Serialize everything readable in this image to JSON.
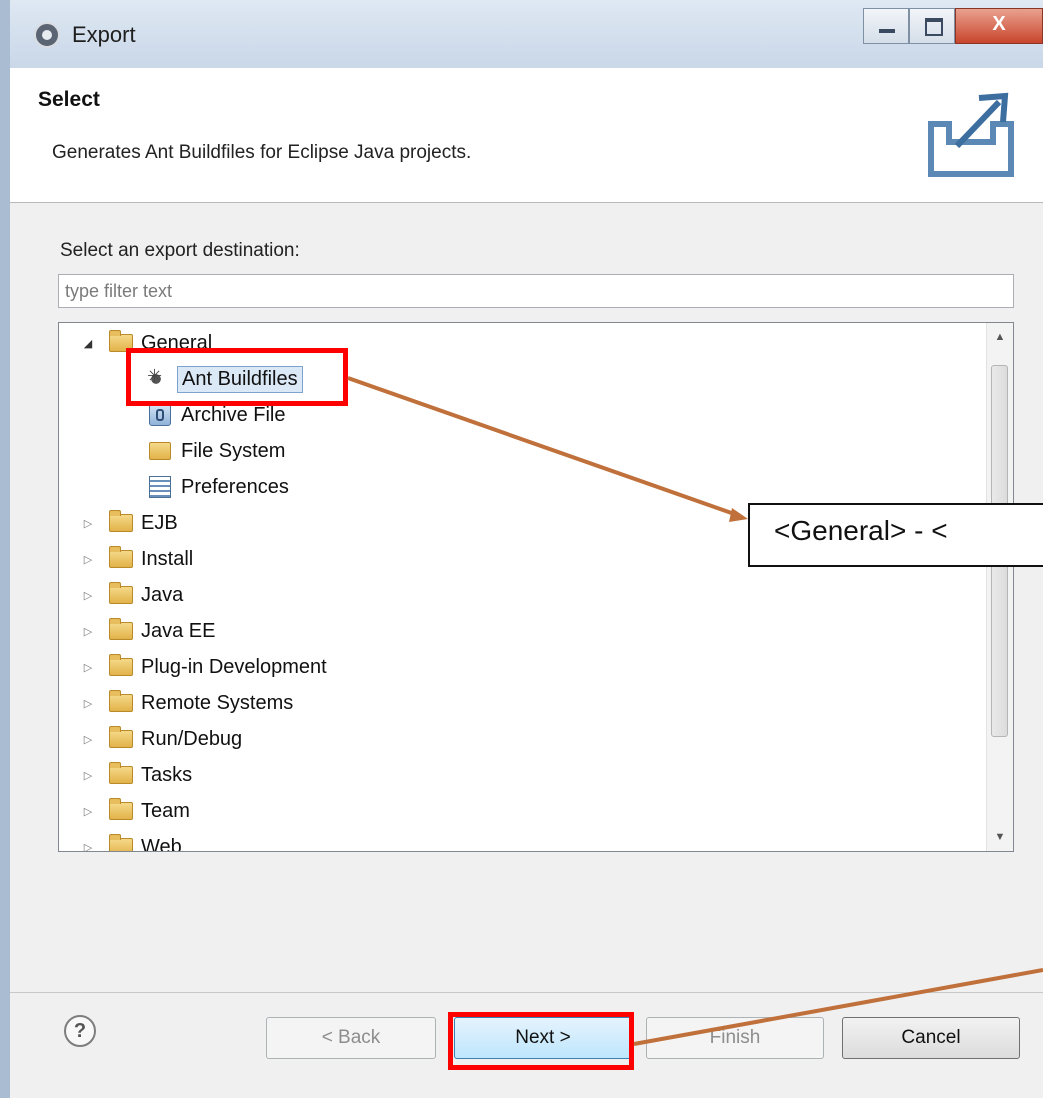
{
  "window": {
    "title": "Export",
    "minimize_icon": "minimize-icon",
    "maximize_icon": "maximize-icon",
    "close_symbol": "X"
  },
  "header": {
    "title": "Select",
    "description": "Generates Ant Buildfiles for Eclipse Java projects.",
    "icon": "export-banner-icon"
  },
  "body": {
    "prompt": "Select an export destination:",
    "filter_placeholder": "type filter text"
  },
  "tree": {
    "general": {
      "label": "General",
      "expanded": true,
      "children": [
        {
          "label": "Ant Buildfiles",
          "icon": "ant-icon",
          "selected": true
        },
        {
          "label": "Archive File",
          "icon": "archive-file-icon"
        },
        {
          "label": "File System",
          "icon": "folder-icon"
        },
        {
          "label": "Preferences",
          "icon": "preferences-icon"
        }
      ]
    },
    "categories": [
      {
        "label": "EJB"
      },
      {
        "label": "Install"
      },
      {
        "label": "Java"
      },
      {
        "label": "Java EE"
      },
      {
        "label": "Plug-in Development"
      },
      {
        "label": "Remote Systems"
      },
      {
        "label": "Run/Debug"
      },
      {
        "label": "Tasks"
      },
      {
        "label": "Team"
      },
      {
        "label": "Web"
      }
    ]
  },
  "footer": {
    "help_symbol": "?",
    "back_label": "< Back",
    "next_label": "Next >",
    "finish_label": "Finish",
    "cancel_label": "Cancel"
  },
  "annotation": {
    "callout_text": "<General> - <",
    "highlight_color": "#ff0000",
    "arrow_color": "#c0703a"
  }
}
